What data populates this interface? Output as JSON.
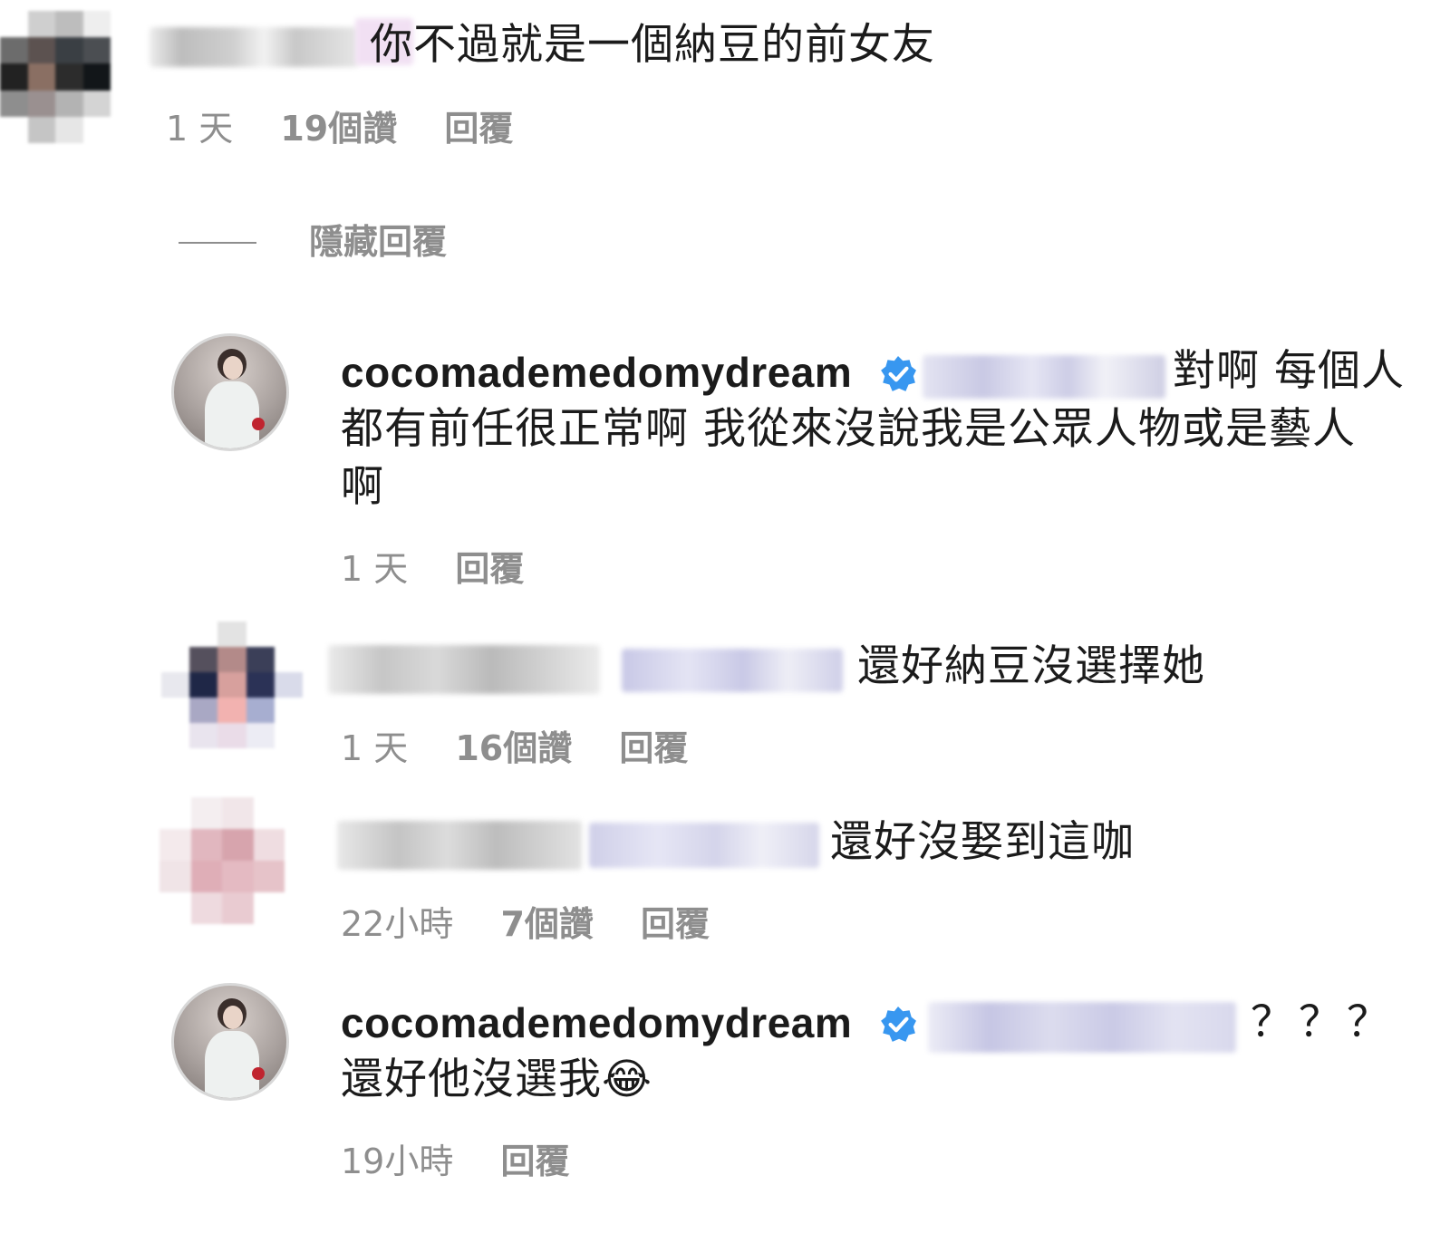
{
  "comment_1": {
    "text": "你不過就是一個納豆的前女友",
    "time": "1 天",
    "likes": "19個讚",
    "reply": "回覆"
  },
  "hide_replies_label": "隱藏回覆",
  "reply_1": {
    "username": "cocomademedomydream",
    "text_line1": "對啊 每個人",
    "text_line2": "都有前任很正常啊 我從來沒說我是公眾人物或是藝人",
    "text_line3": "啊",
    "time": "1 天",
    "reply": "回覆"
  },
  "reply_2": {
    "text": "還好納豆沒選擇她",
    "time": "1 天",
    "likes": "16個讚",
    "reply": "回覆"
  },
  "reply_3": {
    "text": "還好沒娶到這咖",
    "time": "22小時",
    "likes": "7個讚",
    "reply": "回覆"
  },
  "reply_4": {
    "username": "cocomademedomydream",
    "text_line1": "？？？",
    "text_line2": "還好他沒選我",
    "emoji": "😂",
    "time": "19小時",
    "reply": "回覆"
  },
  "colors": {
    "text": "#1b1b1b",
    "meta": "#8e8e8e",
    "verified": "#3897f0"
  },
  "icons": {
    "verified": "verified-badge-icon"
  }
}
